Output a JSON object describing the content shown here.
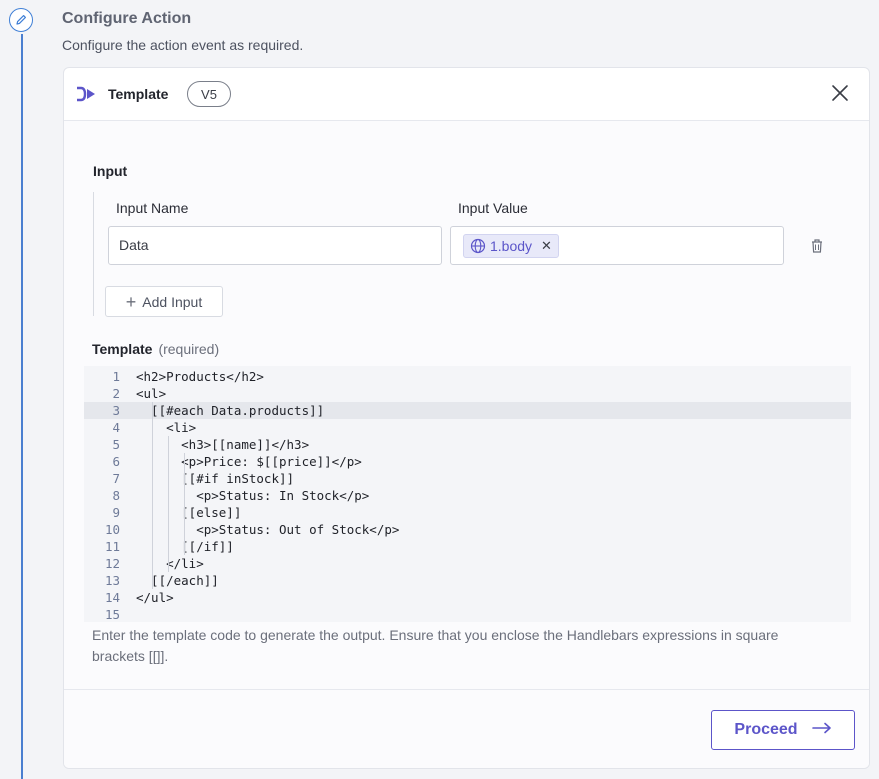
{
  "section": {
    "title": "Configure Action",
    "subtitle": "Configure the action event as required."
  },
  "card": {
    "title": "Template",
    "version": "V5",
    "icons": {
      "header": "template-arrow-icon",
      "close": "close-icon"
    }
  },
  "input": {
    "heading": "Input",
    "name_label": "Input Name",
    "value_label": "Input Value",
    "rows": [
      {
        "name": "Data",
        "value_chip": "1.body",
        "chip_icon": "globe-icon"
      }
    ],
    "add_label": "Add Input"
  },
  "template": {
    "label": "Template",
    "required": "(required)",
    "active_line": 3,
    "lines": [
      {
        "num": "1",
        "text": "<h2>Products</h2>"
      },
      {
        "num": "2",
        "text": "<ul>"
      },
      {
        "num": "3",
        "text": "  [[#each Data.products]]"
      },
      {
        "num": "4",
        "text": "    <li>"
      },
      {
        "num": "5",
        "text": "      <h3>[[name]]</h3>"
      },
      {
        "num": "6",
        "text": "      <p>Price: $[[price]]</p>"
      },
      {
        "num": "7",
        "text": "      [[#if inStock]]"
      },
      {
        "num": "8",
        "text": "        <p>Status: In Stock</p>"
      },
      {
        "num": "9",
        "text": "      [[else]]"
      },
      {
        "num": "10",
        "text": "        <p>Status: Out of Stock</p>"
      },
      {
        "num": "11",
        "text": "      [[/if]]"
      },
      {
        "num": "12",
        "text": "    </li>"
      },
      {
        "num": "13",
        "text": "  [[/each]]"
      },
      {
        "num": "14",
        "text": "</ul>"
      },
      {
        "num": "15",
        "text": ""
      }
    ],
    "help": "Enter the template code to generate the output. Ensure that you enclose the Handlebars expressions in square brackets [[]]."
  },
  "footer": {
    "proceed_label": "Proceed"
  },
  "colors": {
    "accent": "#5c55c9",
    "timeline": "#4a7fd0",
    "chip_bg": "#e8e9f9"
  }
}
